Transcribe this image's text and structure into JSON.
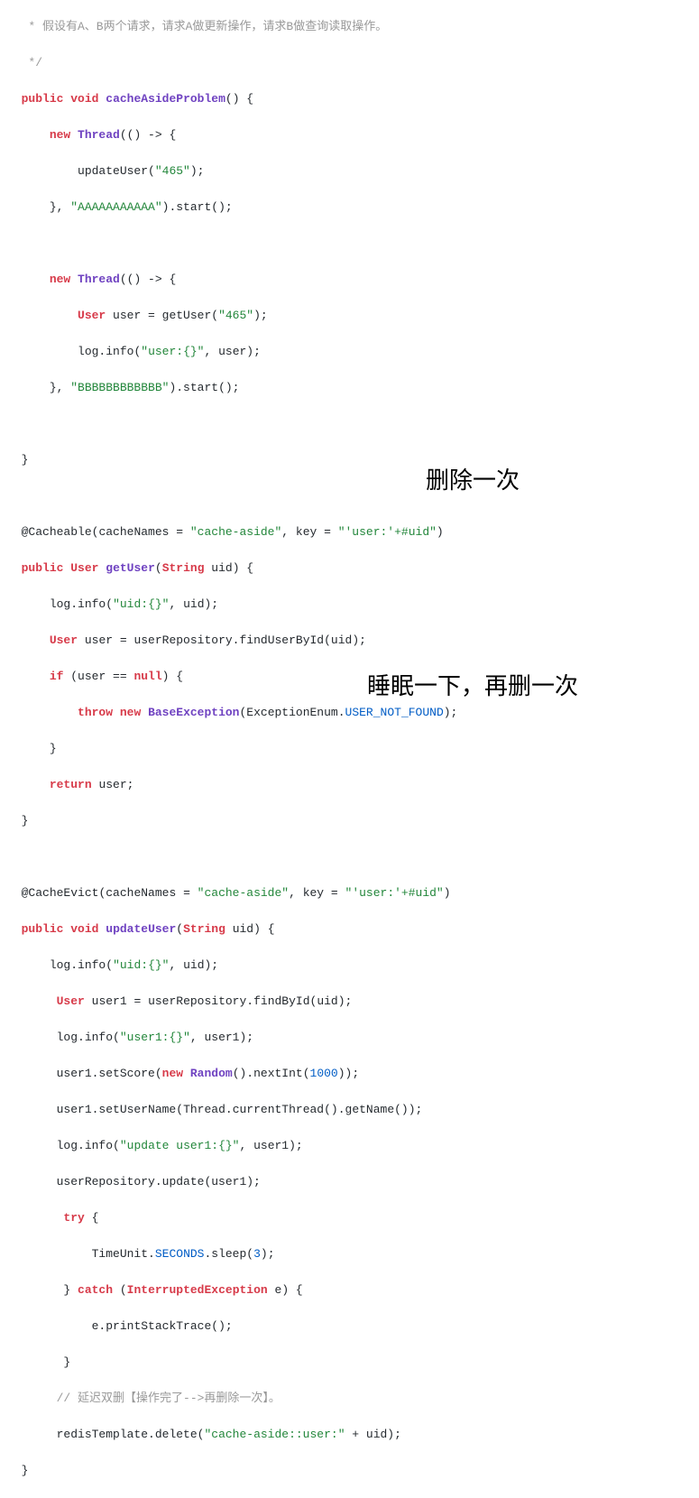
{
  "code": {
    "l1": "   * 假设有A、B两个请求，请求A做更新操作，请求B做查询读取操作。",
    "l2": "   */",
    "l3_public": "public",
    "l3_void": "void",
    "l3_method": "cacheAsideProblem",
    "l4_new": "new",
    "l4_thread": "Thread",
    "l5_method": "updateUser",
    "l5_arg": "\"465\"",
    "l6_threadname": "\"AAAAAAAAAAA\"",
    "l6_start": "start",
    "l8_new": "new",
    "l8_thread": "Thread",
    "l9_user": "User",
    "l9_getuser": "getUser",
    "l9_arg": "\"465\"",
    "l10_log": "log",
    "l10_info": "info",
    "l10_str": "\"user:{}\"",
    "l11_threadname": "\"BBBBBBBBBBBB\"",
    "l11_start": "start",
    "l14_anno": "@Cacheable",
    "l14_cn": "cacheNames",
    "l14_cnval": "\"cache-aside\"",
    "l14_key": "key",
    "l14_keyval": "\"'user:'+#uid\"",
    "l15_public": "public",
    "l15_user": "User",
    "l15_method": "getUser",
    "l15_string": "String",
    "l16_log": "log",
    "l16_info": "info",
    "l16_str": "\"uid:{}\"",
    "l17_user": "User",
    "l17_repo": "userRepository",
    "l17_find": "findUserById",
    "l18_if": "if",
    "l18_null": "null",
    "l19_throw": "throw",
    "l19_new": "new",
    "l19_exc": "BaseException",
    "l19_enum": "ExceptionEnum",
    "l19_const": "USER_NOT_FOUND",
    "l21_return": "return",
    "l24_anno": "@CacheEvict",
    "l24_cn": "cacheNames",
    "l24_cnval": "\"cache-aside\"",
    "l24_key": "key",
    "l24_keyval": "\"'user:'+#uid\"",
    "l25_public": "public",
    "l25_void": "void",
    "l25_method": "updateUser",
    "l25_string": "String",
    "l26_log": "log",
    "l26_info": "info",
    "l26_str": "\"uid:{}\"",
    "l27_user": "User",
    "l27_repo": "userRepository",
    "l27_find": "findById",
    "l28_log": "log",
    "l28_info": "info",
    "l28_str": "\"user1:{}\"",
    "l29_setscore": "setScore",
    "l29_new": "new",
    "l29_random": "Random",
    "l29_nextint": "nextInt",
    "l29_num": "1000",
    "l30_setuser": "setUserName",
    "l30_thread": "Thread",
    "l30_curthread": "currentThread",
    "l30_getname": "getName",
    "l31_log": "log",
    "l31_info": "info",
    "l31_str": "\"update user1:{}\"",
    "l32_repo": "userRepository",
    "l32_update": "update",
    "l33_try": "try",
    "l34_tu": "TimeUnit",
    "l34_sec": "SECONDS",
    "l34_sleep": "sleep",
    "l34_num": "3",
    "l35_catch": "catch",
    "l35_exc": "InterruptedException",
    "l36_pst": "printStackTrace",
    "l38_comment": "// 延迟双删【操作完了-->再删除一次】。",
    "l39_redis": "redisTemplate",
    "l39_delete": "delete",
    "l39_str": "\"cache-aside::user:\""
  },
  "annotations": {
    "a1": "删除一次",
    "a2": "睡眠一下，再删一次"
  }
}
